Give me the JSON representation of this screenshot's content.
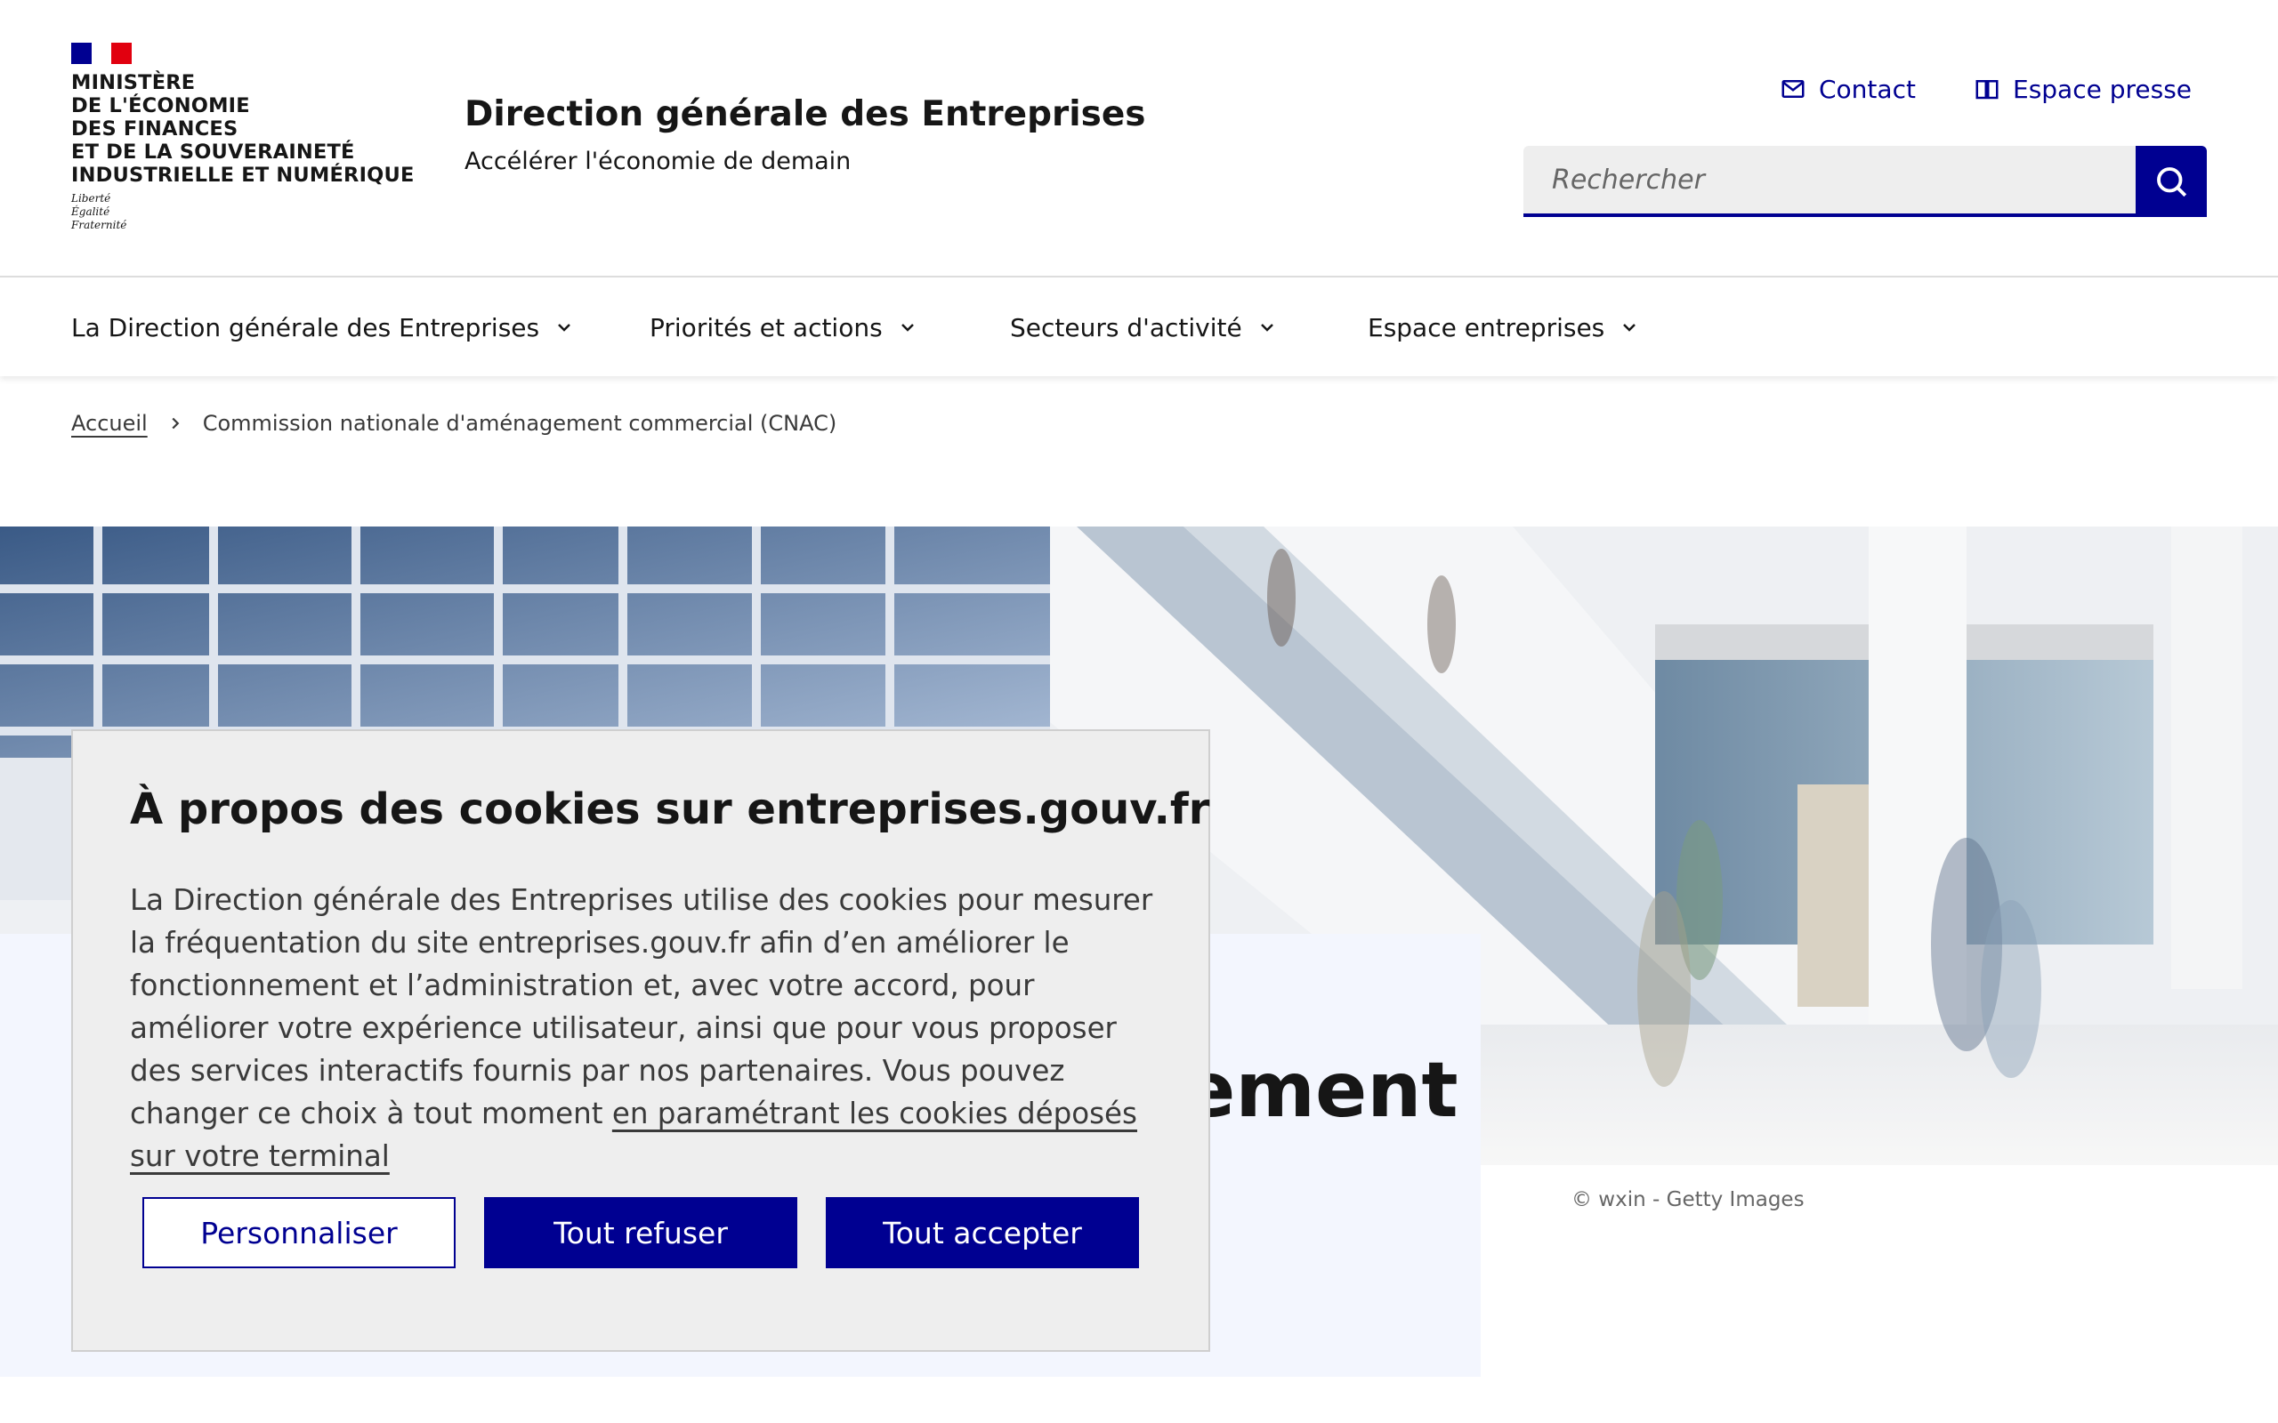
{
  "header": {
    "ministry_lines": [
      "Ministère",
      "de l'économie",
      "des finances",
      "et de la souveraineté",
      "industrielle et numérique"
    ],
    "motto": [
      "Liberté",
      "Égalité",
      "Fraternité"
    ],
    "service_title": "Direction générale des Entreprises",
    "service_tagline": "Accélérer l'économie de demain",
    "tools": {
      "contact": "Contact",
      "presse": "Espace presse"
    },
    "search": {
      "placeholder": "Rechercher"
    },
    "brand_color": "#000091"
  },
  "nav": {
    "items": [
      {
        "label": "La Direction générale des Entreprises"
      },
      {
        "label": "Priorités et actions"
      },
      {
        "label": "Secteurs d'activité"
      },
      {
        "label": "Espace entreprises"
      }
    ]
  },
  "breadcrumb": {
    "home": "Accueil",
    "current": "Commission nationale d'aménagement commercial (CNAC)"
  },
  "hero": {
    "title_fragment": "ement",
    "credit": "© wxin - Getty Images"
  },
  "cookie": {
    "title": "À propos des cookies sur entreprises.gouv.fr",
    "body": "La Direction générale des Entreprises utilise des cookies pour mesurer la fréquentation du site entreprises.gouv.fr afin d’en améliorer le fonctionnement et l’administration et, avec votre accord, pour améliorer votre expérience utilisateur, ainsi que pour vous proposer des services interactifs fournis par nos partenaires. Vous pouvez changer ce choix à tout moment ",
    "link": "en paramétrant les cookies déposés sur votre terminal",
    "buttons": {
      "customize": "Personnaliser",
      "refuse": "Tout refuser",
      "accept": "Tout accepter"
    }
  }
}
